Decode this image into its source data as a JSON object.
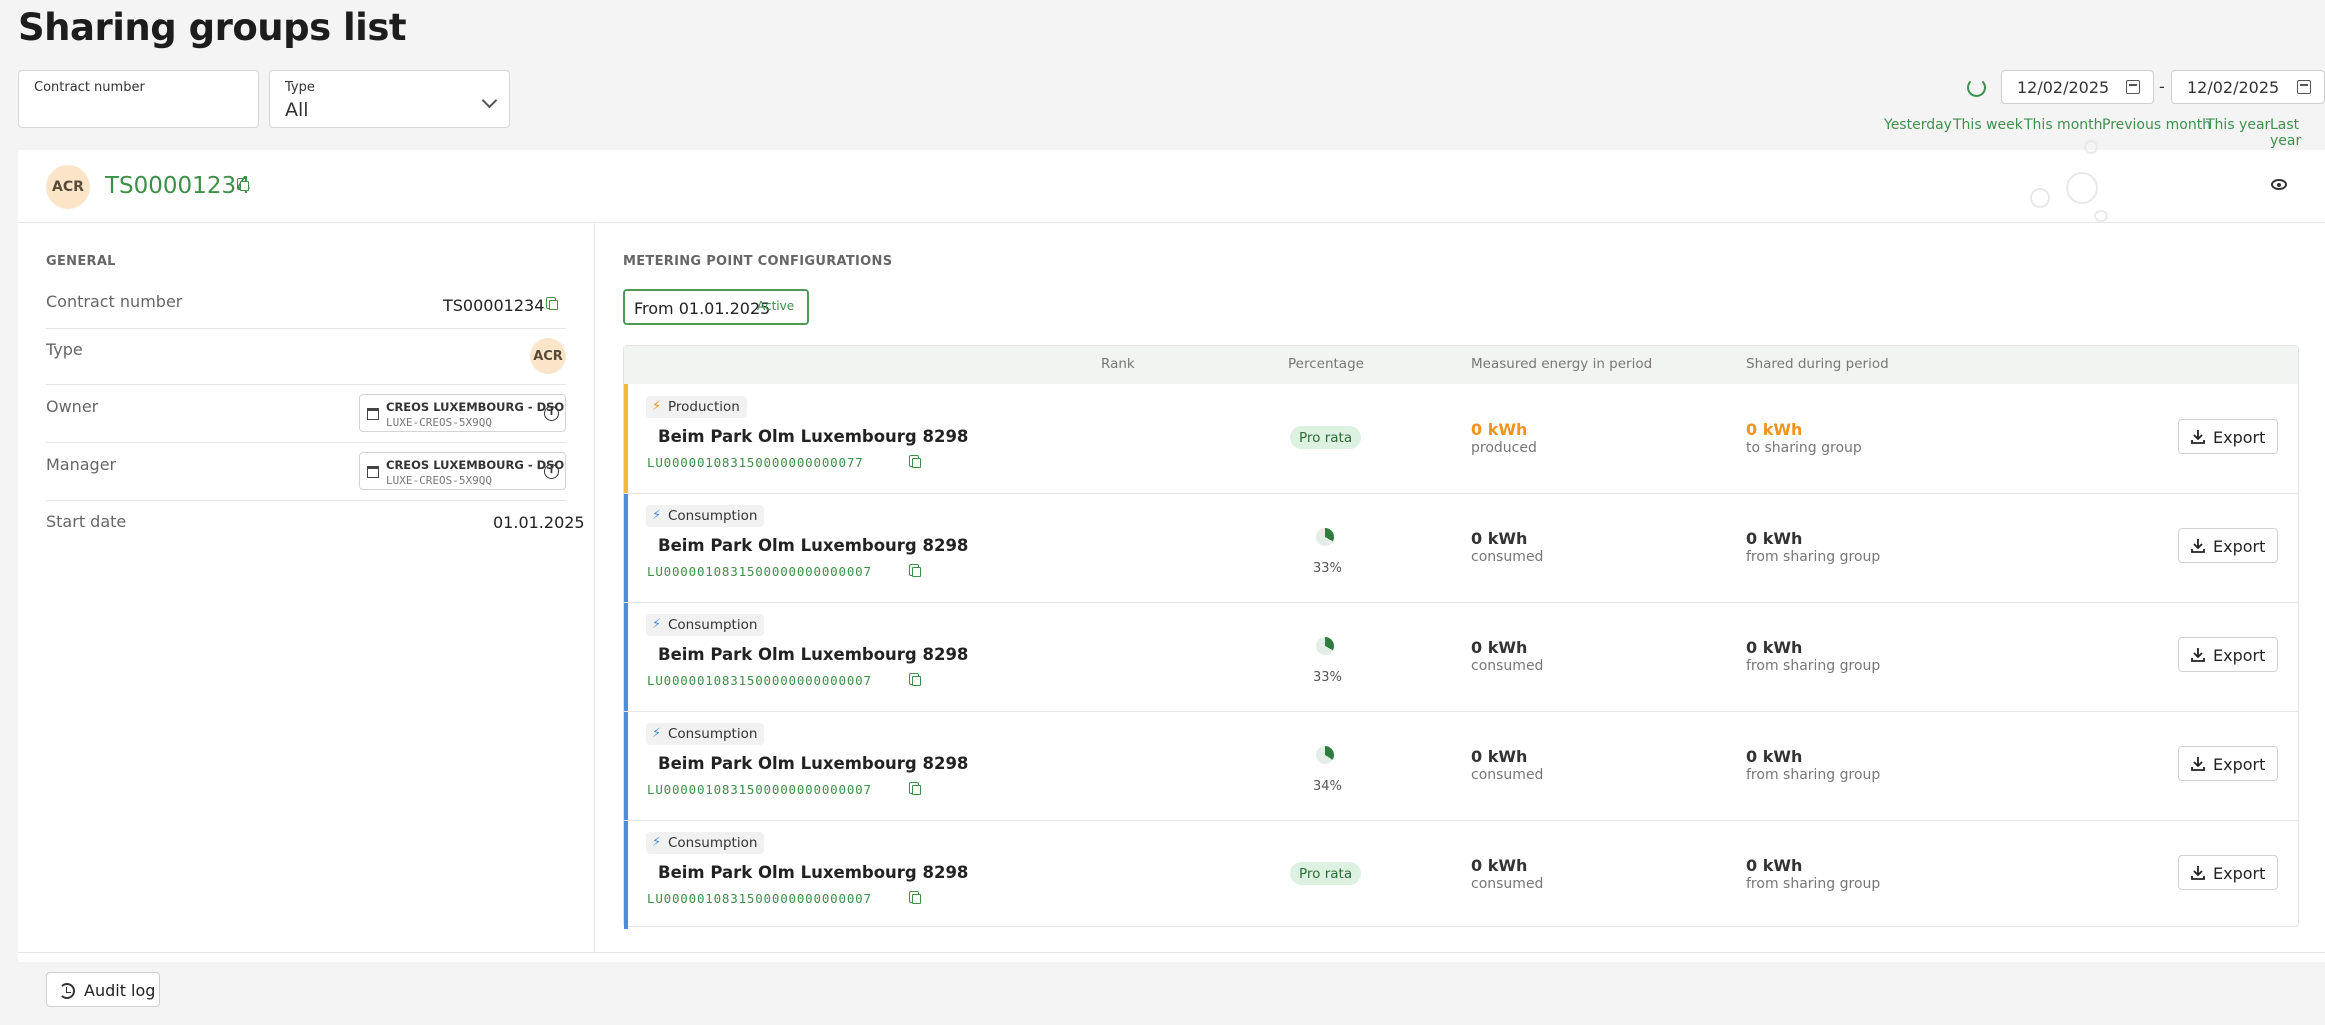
{
  "page": {
    "title": "Sharing groups list"
  },
  "filters": {
    "contract_label": "Contract number",
    "type_label": "Type",
    "type_value": "All",
    "date_from": "12/02/2025",
    "date_separator": "-",
    "date_to": "12/02/2025",
    "quick_ranges": [
      "Yesterday",
      "This week",
      "This month",
      "Previous month",
      "This year",
      "Last year"
    ]
  },
  "group": {
    "avatar": "ACR",
    "id": "TS00001234"
  },
  "general": {
    "title": "GENERAL",
    "contract_label": "Contract number",
    "contract_value": "TS00001234",
    "type_label": "Type",
    "type_badge": "ACR",
    "owner_label": "Owner",
    "owner_name": "CREOS LUXEMBOURG - DSO",
    "owner_code": "LUXE-CREOS-5X9QQ",
    "manager_label": "Manager",
    "manager_name": "CREOS LUXEMBOURG - DSO",
    "manager_code": "LUXE-CREOS-5X9QQ",
    "start_label": "Start date",
    "start_value": "01.01.2025"
  },
  "metering": {
    "title": "METERING POINT CONFIGURATIONS",
    "period_label": "From 01.01.2025",
    "period_status": "Active",
    "columns": [
      "Rank",
      "Percentage",
      "Measured energy in period",
      "Shared during period"
    ],
    "export_label": "Export",
    "rows": [
      {
        "kind": "Production",
        "name": "Beim Park Olm Luxembourg 8298",
        "code": "LU000001083150000000000077",
        "percentage": "Pro rata",
        "measured": "0 kWh",
        "measured_sub": "produced",
        "shared": "0 kWh",
        "shared_sub": "to sharing group"
      },
      {
        "kind": "Consumption",
        "name": "Beim Park Olm Luxembourg 8298",
        "code": "LU0000010831500000000000007",
        "percentage": "33%",
        "pct_value": 33,
        "measured": "0 kWh",
        "measured_sub": "consumed",
        "shared": "0 kWh",
        "shared_sub": "from sharing group"
      },
      {
        "kind": "Consumption",
        "name": "Beim Park Olm Luxembourg 8298",
        "code": "LU0000010831500000000000007",
        "percentage": "33%",
        "pct_value": 33,
        "measured": "0 kWh",
        "measured_sub": "consumed",
        "shared": "0 kWh",
        "shared_sub": "from sharing group"
      },
      {
        "kind": "Consumption",
        "name": "Beim Park Olm Luxembourg 8298",
        "code": "LU0000010831500000000000007",
        "percentage": "34%",
        "pct_value": 34,
        "measured": "0 kWh",
        "measured_sub": "consumed",
        "shared": "0 kWh",
        "shared_sub": "from sharing group"
      },
      {
        "kind": "Consumption",
        "name": "Beim Park Olm Luxembourg 8298",
        "code": "LU0000010831500000000000007",
        "percentage": "Pro rata",
        "measured": "0 kWh",
        "measured_sub": "consumed",
        "shared": "0 kWh",
        "shared_sub": "from sharing group"
      }
    ]
  },
  "footer": {
    "audit_label": "Audit log"
  },
  "colors": {
    "accent_green": "#3e8f47",
    "production_bar": "#f5b83d",
    "consumption_bar": "#4a8fd9",
    "produced_orange": "#f0941e"
  }
}
